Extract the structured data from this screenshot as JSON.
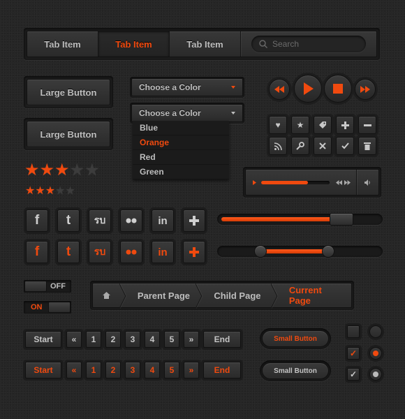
{
  "tabs": [
    "Tab Item",
    "Tab Item",
    "Tab Item"
  ],
  "search": {
    "placeholder": "Search",
    "icon": "search-icon"
  },
  "large_buttons": [
    "Large Button",
    "Large Button"
  ],
  "select_1": {
    "value": "Choose a Color"
  },
  "select_2": {
    "value": "Choose a Color",
    "options": [
      "Blue",
      "Orange",
      "Red",
      "Green"
    ]
  },
  "rating_large": {
    "filled": 3,
    "total": 5
  },
  "rating_small": {
    "filled": 3,
    "total": 5
  },
  "media": {
    "progress": 0.68
  },
  "sliders": {
    "single": 0.75,
    "range": [
      0.26,
      0.67
    ]
  },
  "toggles": {
    "off_label": "OFF",
    "on_label": "ON"
  },
  "breadcrumb": {
    "items": [
      "Parent Page",
      "Child Page",
      "Current Page"
    ]
  },
  "pagination": {
    "start": "Start",
    "prev": "«",
    "pages": [
      "1",
      "2",
      "3",
      "4",
      "5"
    ],
    "next": "»",
    "end": "End"
  },
  "small_buttons": [
    "Small Button",
    "Small Button"
  ],
  "social": [
    "f",
    "t",
    "su",
    "flickr",
    "in",
    "+"
  ],
  "colors": {
    "accent": "#f04a0f",
    "bg": "#262626",
    "text": "#bdbdbd"
  }
}
